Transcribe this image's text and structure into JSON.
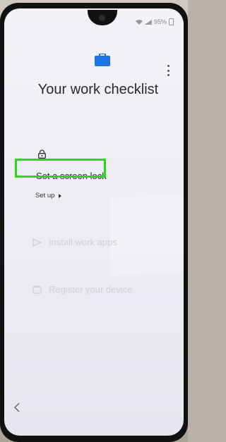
{
  "status_bar": {
    "battery": "95%"
  },
  "header": {
    "title": "Your work checklist",
    "icon": "briefcase-icon",
    "menu_icon": "more-vert-icon"
  },
  "steps": [
    {
      "icon": "lock-icon",
      "label": "Set a screen lock",
      "action_label": "Set up",
      "enabled": true
    },
    {
      "icon": "apps-icon",
      "label": "Install work apps",
      "enabled": false
    },
    {
      "icon": "device-icon",
      "label": "Register your device",
      "enabled": false
    }
  ],
  "nav": {
    "back_icon": "chevron-left-icon"
  },
  "colors": {
    "accent": "#1a73e8",
    "highlight": "#1fe00e"
  }
}
